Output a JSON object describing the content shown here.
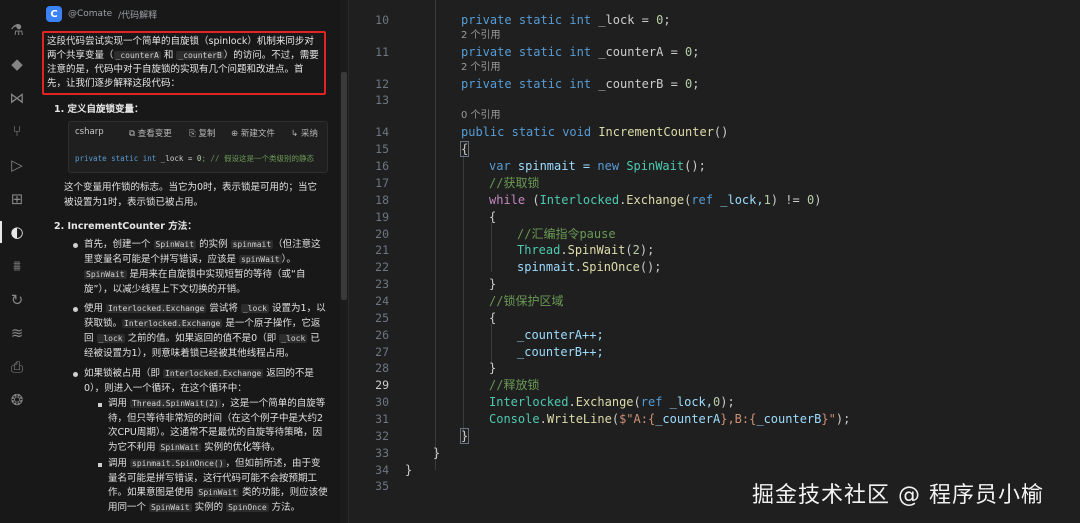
{
  "chat": {
    "header_user": "@Comate",
    "header_cmd": "/代码解释",
    "intro": {
      "p1": "这段代码尝试实现一个简单的自旋锁（spinlock）机制来同步对两个共享变量（",
      "c1": "_counterA",
      "p2": " 和 ",
      "c2": "_counterB",
      "p3": "）的访问。不过，需要注意的是，代码中对于自旋锁的实现有几个问题和改进点。首先，让我们逐步解释这段代码："
    },
    "section1": "1. 定义自旋锁变量：",
    "codebox": {
      "lang": "csharp",
      "act_view": "查看变更",
      "act_copy": "复制",
      "act_new": "新建文件",
      "act_adopt": "采纳",
      "kw1": "private",
      "kw2": "static",
      "kw3": "int",
      "rest": " _lock = ",
      "num": "0",
      "comment": "; // 假设这是一个类级别的静态"
    },
    "s1_desc": "这个变量用作锁的标志。当它为0时，表示锁是可用的；当它被设置为1时，表示锁已被占用。",
    "section2": "2. IncrementCounter 方法：",
    "b1": {
      "t1": "首先，创建一个 ",
      "c1": "SpinWait",
      "t2": " 的实例 ",
      "c2": "spinmait",
      "t3": "（但注意这里变量名可能是个拼写错误，应该是 ",
      "c3": "spinWait",
      "t4": "）。",
      "c4": "SpinWait",
      "t5": " 是用来在自旋锁中实现短暂的等待（或“自旋”），以减少线程上下文切换的开销。"
    },
    "b2": {
      "t1": "使用 ",
      "c1": "Interlocked.Exchange",
      "t2": " 尝试将 ",
      "c2": "_lock",
      "t3": " 设置为1，以获取锁。",
      "c3": "Interlocked.Exchange",
      "t4": " 是一个原子操作，它返回 ",
      "c4": "_lock",
      "t5": " 之前的值。如果返回的值不是0（即 ",
      "c5": "_lock",
      "t6": " 已经被设置为1），则意味着锁已经被其他线程占用。"
    },
    "b3": {
      "t1": "如果锁被占用（即 ",
      "c1": "Interlocked.Exchange",
      "t2": " 返回的不是0），则进入一个循环，在这个循环中："
    },
    "sb1": {
      "t1": "调用 ",
      "c1": "Thread.SpinWait(2)",
      "t2": "，这是一个简单的自旋等待，但只等待非常短的时间（在这个例子中是大约2次CPU周期）。这通常不是最优的自旋等待策略，因为它不利用 ",
      "c2": "SpinWait",
      "t3": " 实例的优化等待。"
    },
    "sb2": {
      "t1": "调用 ",
      "c1": "spinmait.SpinOnce()",
      "t2": "，但如前所述，由于变量名可能是拼写错误，这行代码可能不会按预期工作。如果意图是使用 ",
      "c2": "SpinWait",
      "t3": " 类的功能，则应该使用同一个 ",
      "c3": "SpinWait",
      "t4": " 实例的 ",
      "c4": "SpinOnce",
      "t5": " 方法。"
    }
  },
  "editor": {
    "line_numbers": [
      "10",
      "11",
      "12",
      "13",
      "14",
      "15",
      "16",
      "17",
      "18",
      "19",
      "20",
      "21",
      "22",
      "23",
      "24",
      "25",
      "26",
      "27",
      "28",
      "29",
      "30",
      "31",
      "32",
      "33",
      "34",
      "35"
    ],
    "codelens": [
      "2 个引用",
      "2 个引用",
      "2 个引用",
      "0 个引用"
    ],
    "tokens": {
      "private": "private",
      "static": "static",
      "int": "int",
      "void": "void",
      "public": "public",
      "var": "var",
      "new": "new",
      "while": "while",
      "ref": "ref",
      "lock_decl": " _lock = ",
      "ca_decl": " _counterA = ",
      "cb_decl": " _counterB = ",
      "zero": "0",
      "semi": ";",
      "method": "IncrementCounter",
      "parens": "()",
      "open": "{",
      "close": "}",
      "spin_decl": " spinmait = ",
      "spinwait_type": "SpinWait",
      "cm_acquire": "//获取锁",
      "interlocked": "Interlocked",
      "exchange": "Exchange",
      "while_args": " _lock,",
      "one": "1",
      "ne": ") != ",
      "close_paren": ")",
      "cm_pause": "//汇编指令pause",
      "thread": "Thread",
      "two": "2",
      "spinmait_var": "spinmait",
      "spinonce": "SpinOnce",
      "cm_protect": "//锁保护区域",
      "ca_inc": "_counterA++;",
      "cb_inc": "_counterB++;",
      "cm_release": "//释放锁",
      "release_args": " _lock,",
      "console": "Console",
      "writeline": "WriteLine",
      "str_dollar": "$\"A:{",
      "ca": "_counterA",
      "str_mid": "},B:{",
      "cb": "_counterB",
      "str_end": "}\"",
      "end": ");"
    }
  },
  "watermark": "掘金技术社区 @ 程序员小榆"
}
